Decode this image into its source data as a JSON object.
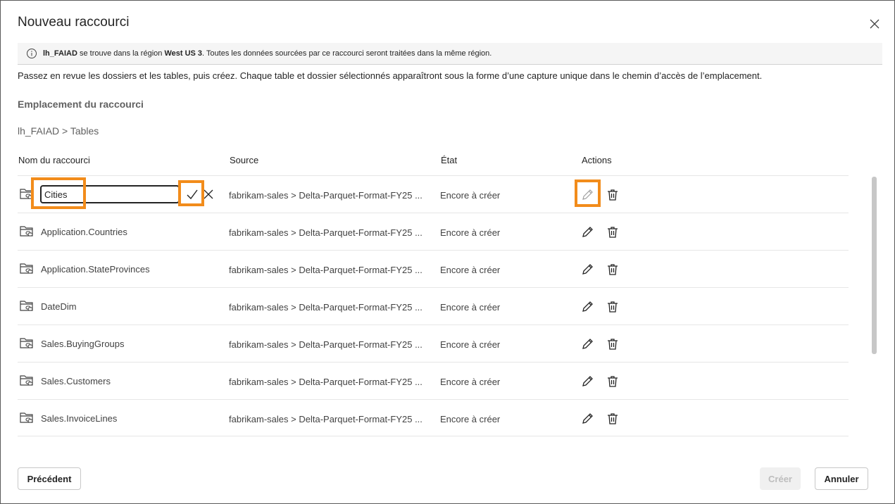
{
  "dialog": {
    "title": "Nouveau raccourci",
    "close_icon": "close-icon"
  },
  "banner": {
    "bold_name": "lh_FAIAD",
    "text_part1": " se trouve dans la région ",
    "bold_region": "West US 3",
    "text_part2": ". Toutes les données sourcées par ce raccourci seront traitées dans la même région."
  },
  "description": "Passez en revue les dossiers et les tables, puis créez. Chaque table et dossier sélectionnés apparaîtront sous la forme d’une capture unique dans le chemin d’accès de l’emplacement.",
  "location": {
    "label": "Emplacement du raccourci",
    "breadcrumb": "lh_FAIAD > Tables"
  },
  "table": {
    "headers": {
      "name": "Nom du raccourci",
      "source": "Source",
      "state": "État",
      "actions": "Actions"
    },
    "editing_value": "Cities",
    "rows": [
      {
        "name": "Cities",
        "source": "fabrikam-sales > Delta-Parquet-Format-FY25 ...",
        "state": "Encore à créer"
      },
      {
        "name": "Application.Countries",
        "source": "fabrikam-sales > Delta-Parquet-Format-FY25 ...",
        "state": "Encore à créer"
      },
      {
        "name": "Application.StateProvinces",
        "source": "fabrikam-sales > Delta-Parquet-Format-FY25 ...",
        "state": "Encore à créer"
      },
      {
        "name": "DateDim",
        "source": "fabrikam-sales > Delta-Parquet-Format-FY25 ...",
        "state": "Encore à créer"
      },
      {
        "name": "Sales.BuyingGroups",
        "source": "fabrikam-sales > Delta-Parquet-Format-FY25 ...",
        "state": "Encore à créer"
      },
      {
        "name": "Sales.Customers",
        "source": "fabrikam-sales > Delta-Parquet-Format-FY25 ...",
        "state": "Encore à créer"
      },
      {
        "name": "Sales.InvoiceLines",
        "source": "fabrikam-sales > Delta-Parquet-Format-FY25 ...",
        "state": "Encore à créer"
      }
    ]
  },
  "footer": {
    "previous_label": "Précédent",
    "create_label": "Créer",
    "cancel_label": "Annuler"
  },
  "colors": {
    "highlight": "#f28c1b",
    "border": "#e6e6e6",
    "disabled_text": "#bdbdbd"
  }
}
